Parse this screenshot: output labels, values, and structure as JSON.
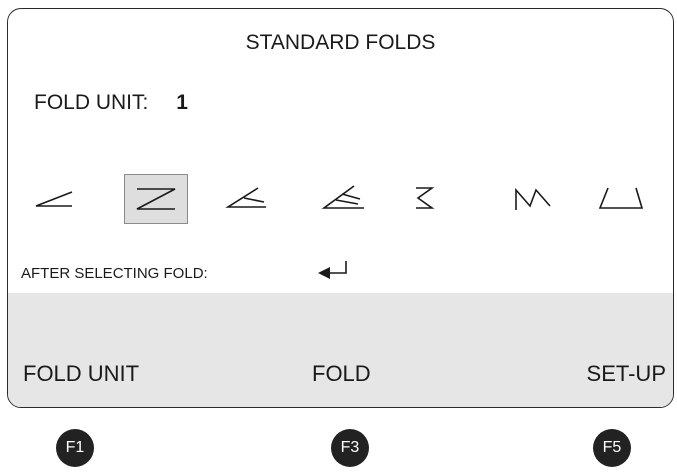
{
  "screen": {
    "title": "STANDARD FOLDS",
    "fold_unit_label": "FOLD UNIT:",
    "fold_unit_value": "1",
    "fold_types": [
      {
        "icon": "single-fold-icon",
        "selected": false
      },
      {
        "icon": "z-fold-icon",
        "selected": true
      },
      {
        "icon": "letter-fold-icon",
        "selected": false
      },
      {
        "icon": "double-parallel-fold-icon",
        "selected": false
      },
      {
        "icon": "accordion-fold-icon",
        "selected": false
      },
      {
        "icon": "w-fold-icon",
        "selected": false
      },
      {
        "icon": "gate-fold-icon",
        "selected": false
      }
    ],
    "after_selecting_label": "AFTER SELECTING FOLD:",
    "enter_icon": "enter-icon"
  },
  "softkeys": {
    "f1_label": "FOLD UNIT",
    "f3_label": "FOLD",
    "f5_label": "SET-UP"
  },
  "function_keys": {
    "f1": "F1",
    "f3": "F3",
    "f5": "F5"
  },
  "colors": {
    "selected_bg": "#dedede",
    "softbar_bg": "#e6e6e6",
    "key_bg": "#222222"
  }
}
